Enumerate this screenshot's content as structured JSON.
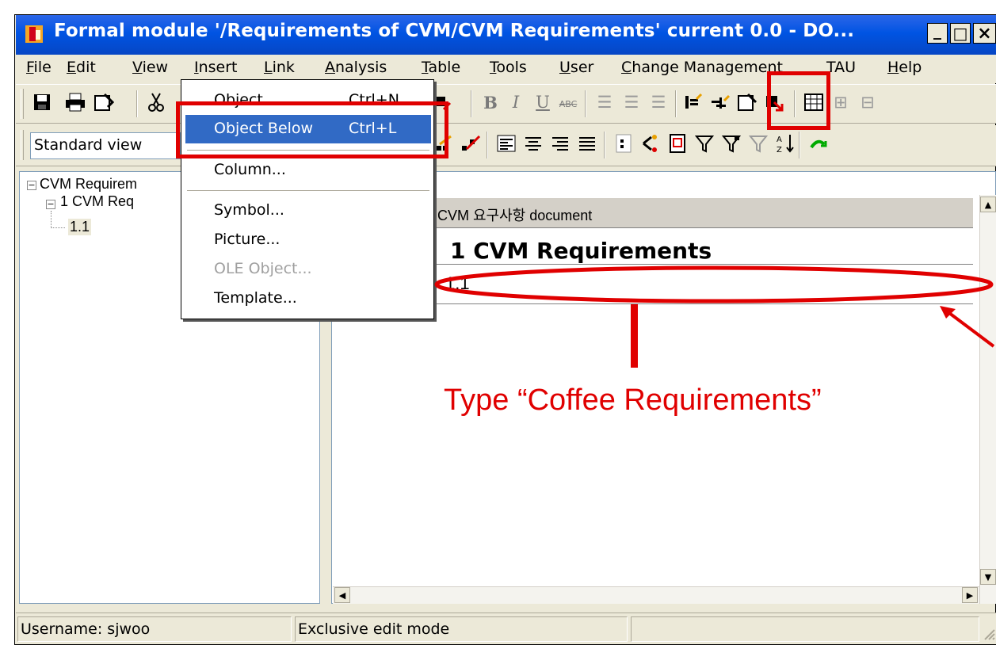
{
  "window": {
    "title": "Formal module '/Requirements of CVM/CVM Requirements' current 0.0 - DO...",
    "minimize_glyph": "_",
    "maximize_glyph": "□",
    "close_glyph": "×"
  },
  "menubar": {
    "items": [
      {
        "mnemonic": "F",
        "rest": "ile"
      },
      {
        "mnemonic": "E",
        "rest": "dit"
      },
      {
        "mnemonic": "V",
        "rest": "iew"
      },
      {
        "mnemonic": "I",
        "rest": "nsert"
      },
      {
        "mnemonic": "L",
        "rest": "ink"
      },
      {
        "mnemonic": "A",
        "rest": "nalysis"
      },
      {
        "mnemonic": "T",
        "rest": "able"
      },
      {
        "mnemonic": "T",
        "rest": "ools"
      },
      {
        "mnemonic": "U",
        "rest": "ser"
      },
      {
        "mnemonic": "C",
        "rest": "hange Management"
      },
      {
        "mnemonic": "",
        "rest": "TAU"
      },
      {
        "mnemonic": "H",
        "rest": "elp"
      }
    ]
  },
  "toolbar": {
    "view_select_value": "Standard view"
  },
  "insert_menu": {
    "items": [
      {
        "label": "Object",
        "shortcut": "Ctrl+N",
        "enabled": true,
        "highlighted": false
      },
      {
        "label": "Object Below",
        "shortcut": "Ctrl+L",
        "enabled": true,
        "highlighted": true
      },
      {
        "label": "Column...",
        "shortcut": "",
        "enabled": true,
        "highlighted": false
      },
      {
        "label": "Symbol...",
        "shortcut": "",
        "enabled": true,
        "highlighted": false
      },
      {
        "label": "Picture...",
        "shortcut": "",
        "enabled": true,
        "highlighted": false
      },
      {
        "label": "OLE Object...",
        "shortcut": "",
        "enabled": false,
        "highlighted": false
      },
      {
        "label": "Template...",
        "shortcut": "",
        "enabled": true,
        "highlighted": false
      }
    ]
  },
  "explorer": {
    "tree": [
      {
        "label": "CVM Requirem",
        "level": 0
      },
      {
        "label": "1 CVM Req",
        "level": 1
      },
      {
        "label": "1.1",
        "level": 2
      }
    ]
  },
  "document": {
    "column_header": "CVM 요구사항 document",
    "rows": [
      {
        "text": "1 CVM Requirements",
        "heading": true
      },
      {
        "text": "1.1",
        "heading": false
      }
    ]
  },
  "statusbar": {
    "username": "Username: sjwoo",
    "mode": "Exclusive edit mode",
    "extra": ""
  },
  "annotation": {
    "text": "Type “Coffee Requirements”",
    "color": "#e00000"
  },
  "colors": {
    "titlebar": "#0054e3",
    "menu_highlight": "#316ac5",
    "annotation_red": "#e00000"
  }
}
